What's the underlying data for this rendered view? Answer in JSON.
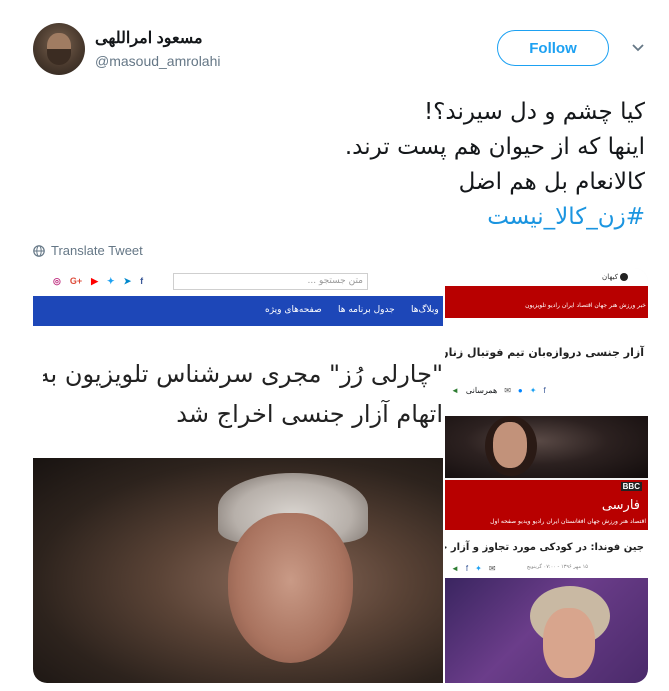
{
  "user": {
    "display_name": "مسعود امراللهی",
    "handle": "@masoud_amrolahi"
  },
  "follow_button": {
    "label": "Follow"
  },
  "tweet": {
    "lines": [
      "کیا چشم و دل سیرند؟!",
      "اینها که از حیوان هم پست ترند.",
      "کالانعام بل هم اضل"
    ],
    "hashtag": "#زن_کالا_نیست"
  },
  "translate": {
    "label": "Translate Tweet"
  },
  "media": {
    "left": {
      "search_placeholder": "متن جستجو ...",
      "nav": [
        "صفحه‌های ویژه",
        "جدول برنامه ها",
        "وبلاگ‌ها"
      ],
      "headline_1": "\"چارلی رُز\" مجری سرشناس تلویزیون به",
      "headline_2": "اتهام آزار جنسی اخراج شد"
    },
    "right": {
      "card1_site": "کیهان",
      "card1_tabs": "خبر  ورزش  هنر  جهان  اقتصاد  ایران  رادیو  تلویزیون",
      "card1_headline": "آزار جنسی دروازه‌بان تیم فوتبال زنان آمریکا متهم",
      "card1_share": "همرسانی",
      "card2_logo": "BBC",
      "card2_title": "فارسی",
      "card2_tabs": "اقتصاد  هنر  ورزش  جهان  افغانستان  ایران  رادیو  ویدیو  صفحه اول",
      "card2_headline": "جین فوندا: در کودکی مورد تجاوز و آزار جنسی قرار گرفتم",
      "card2_meta": "۱۵ مهر ۱۳۹۶ - ۰۷:۰۰ گرینویچ"
    }
  },
  "colors": {
    "accent": "#1da1f2",
    "hashtag": "#1b95e0",
    "nav_blue": "#1d47b8",
    "bbc_red": "#b80000"
  }
}
